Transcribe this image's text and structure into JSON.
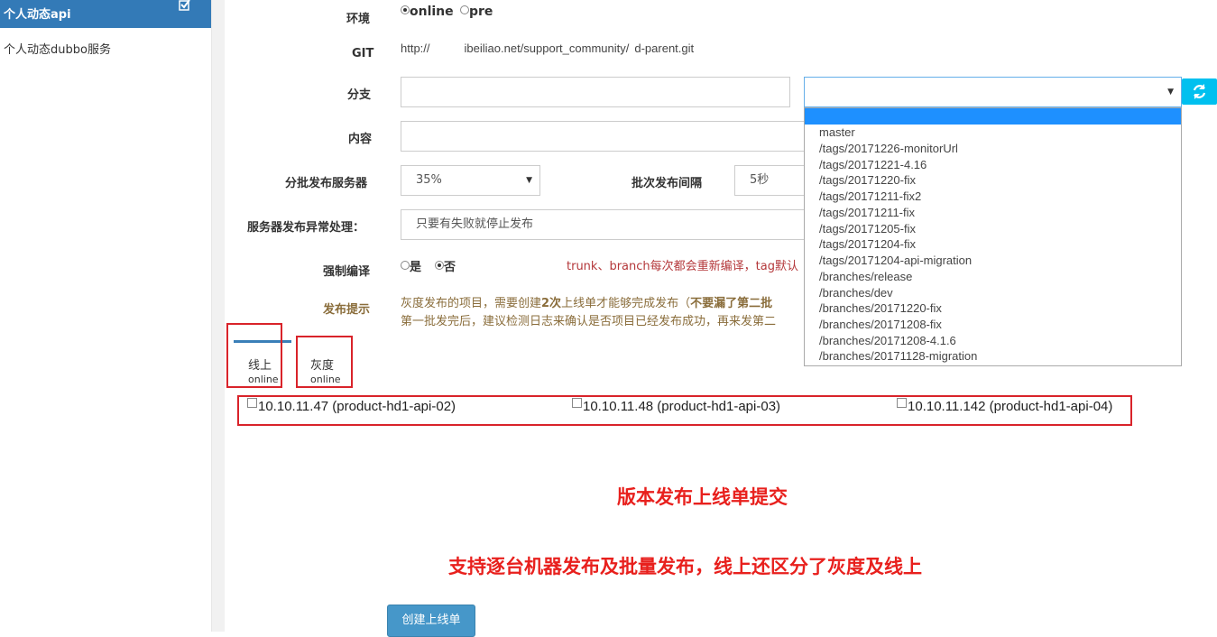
{
  "sidebar": {
    "title": "个人动态api",
    "item": "个人动态dubbo服务"
  },
  "form": {
    "env_label": "环境",
    "env_options": [
      "online",
      "pre"
    ],
    "env_selected": "online",
    "git_label": "GIT",
    "git_url_start": "http://",
    "git_url_mid": "ibeiliao.net/support_community/",
    "git_url_end": "d-parent.git",
    "branch_label": "分支",
    "branch_value": "",
    "content_label": "内容",
    "batch_label": "分批发布服务器",
    "batch_value": "35%",
    "interval_label": "批次发布间隔",
    "interval_value": "5秒",
    "error_label": "服务器发布异常处理：",
    "error_value": "只要有失败就停止发布",
    "compile_label": "强制编译",
    "compile_options": [
      "是",
      "否"
    ],
    "compile_selected": "否",
    "compile_note": "trunk、branch每次都会重新编译，tag默认",
    "hint_label": "发布提示",
    "hint_line1_a": "灰度发布的项目，需要创建",
    "hint_line1_b": "2次",
    "hint_line1_c": "上线单才能够完成发布（",
    "hint_line1_d": "不要漏了第二批",
    "hint_line2": "第一批发完后，建议检测日志来确认是否项目已经发布成功，再来发第二"
  },
  "branch_dropdown": {
    "selected": "",
    "options": [
      "master",
      "/tags/20171226-monitorUrl",
      "/tags/20171221-4.16",
      "/tags/20171220-fix",
      "/tags/20171211-fix2",
      "/tags/20171211-fix",
      "/tags/20171205-fix",
      "/tags/20171204-fix",
      "/tags/20171204-api-migration",
      "/branches/release",
      "/branches/dev",
      "/branches/20171220-fix",
      "/branches/20171208-fix",
      "/branches/20171208-4.1.6",
      "/branches/20171128-migration"
    ]
  },
  "tabs": [
    {
      "label": "线上",
      "sub": "online"
    },
    {
      "label": "灰度",
      "sub": "online"
    }
  ],
  "servers": [
    "10.10.11.47 (product-hd1-api-02)",
    "10.10.11.48 (product-hd1-api-03)",
    "10.10.11.142 (product-hd1-api-04)"
  ],
  "annotations": {
    "line1": "版本发布上线单提交",
    "line2": "支持逐台机器发布及批量发布，线上还区分了灰度及线上"
  },
  "create_button": "创建上线单",
  "colors": {
    "sidebar_header": "#337ab7",
    "refresh_button": "#00c0ef",
    "annotation_red": "#e8201d",
    "highlight_blue": "#1e90ff"
  }
}
